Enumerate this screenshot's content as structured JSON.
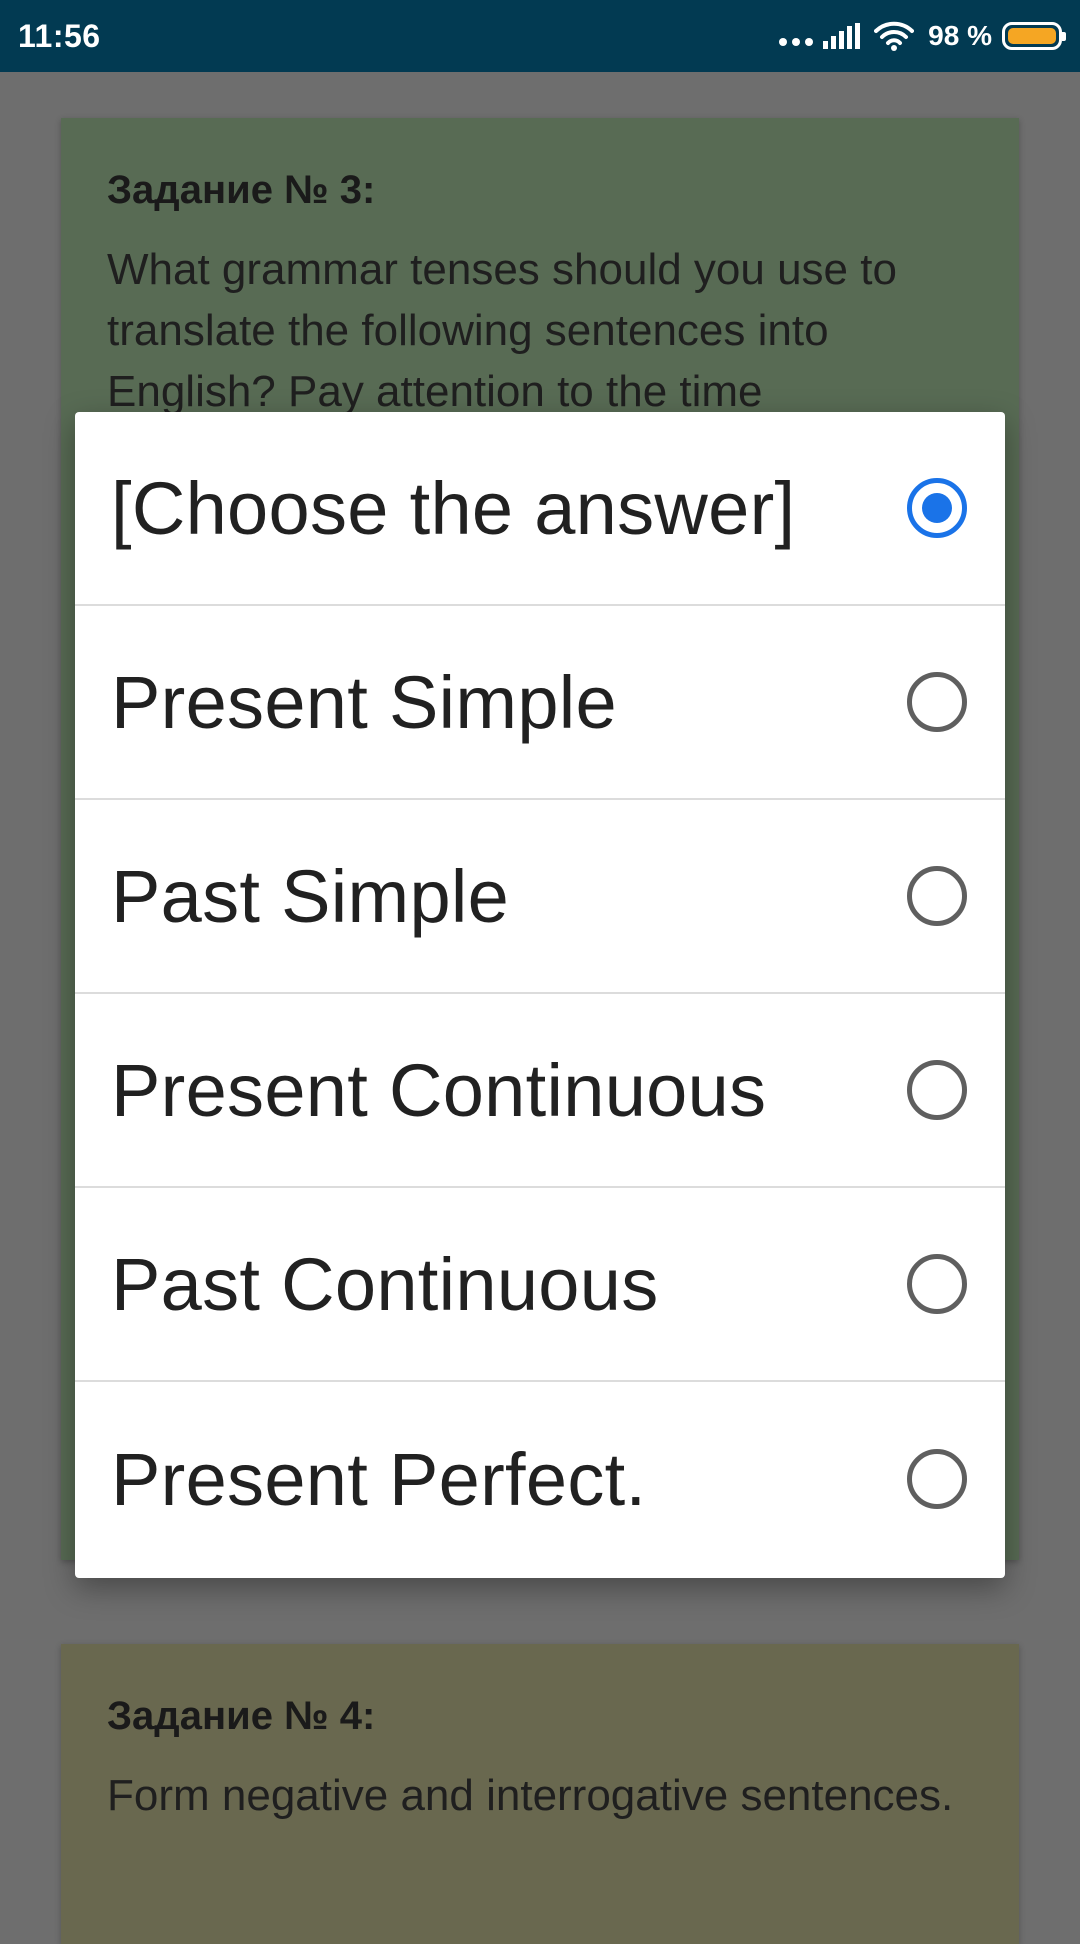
{
  "statusbar": {
    "time": "11:56",
    "battery_percent": "98 %",
    "battery_level": 0.98,
    "icons": [
      "dots-icon",
      "signal-icon",
      "wifi-icon",
      "battery-icon"
    ]
  },
  "task3": {
    "title": "Задание № 3:",
    "text": "What grammar tenses should you use to translate the following sentences into English? Pay attention to the time"
  },
  "task4": {
    "title": "Задание № 4:",
    "text": "Form negative and interrogative sentences."
  },
  "dialog": {
    "options": [
      {
        "label": "[Choose the answer]",
        "selected": true
      },
      {
        "label": "Present Simple",
        "selected": false
      },
      {
        "label": "Past Simple",
        "selected": false
      },
      {
        "label": "Present Continuous",
        "selected": false
      },
      {
        "label": "Past Continuous",
        "selected": false
      },
      {
        "label": "Present Perfect.",
        "selected": false
      }
    ]
  },
  "colors": {
    "status_bar": "#023a52",
    "accent": "#1a73e8",
    "card_task3": "#586b54",
    "card_task4": "#69684f",
    "scrim": "#6e6e6e"
  }
}
